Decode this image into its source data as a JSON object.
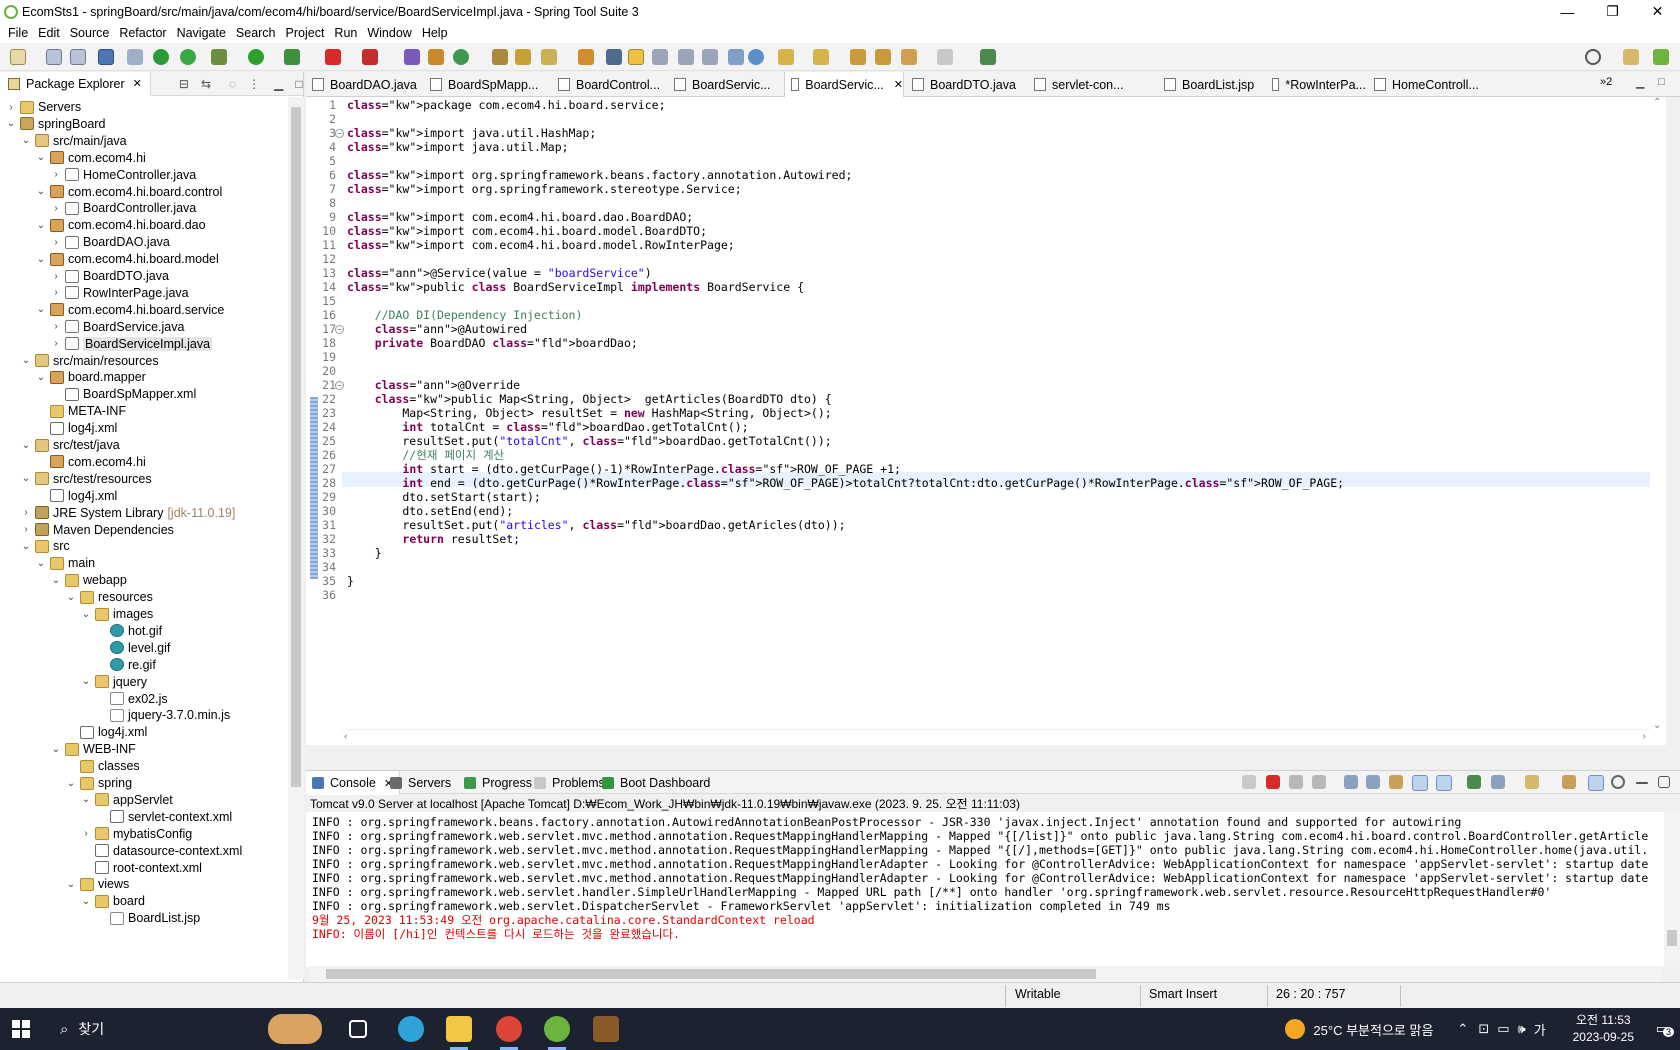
{
  "window": {
    "title": "EcomSts1 - springBoard/src/main/java/com/ecom4/hi/board/service/BoardServiceImpl.java - Spring Tool Suite 3",
    "minimize": "—",
    "maximize": "❐",
    "close": "✕"
  },
  "menu": [
    "File",
    "Edit",
    "Source",
    "Refactor",
    "Navigate",
    "Search",
    "Project",
    "Run",
    "Window",
    "Help"
  ],
  "package_explorer": {
    "tab_label": "Package Explorer",
    "tree": [
      {
        "label": "Servers",
        "icon": "folder",
        "toggle": "›"
      },
      {
        "label": "springBoard",
        "icon": "project",
        "toggle": "⌄"
      },
      {
        "label": "src/main/java",
        "icon": "source-folder",
        "toggle": "⌄"
      },
      {
        "label": "com.ecom4.hi",
        "icon": "package",
        "toggle": "⌄"
      },
      {
        "label": "HomeController.java",
        "icon": "java-file",
        "toggle": "›"
      },
      {
        "label": "com.ecom4.hi.board.control",
        "icon": "package",
        "toggle": "⌄"
      },
      {
        "label": "BoardController.java",
        "icon": "java-file",
        "toggle": "›"
      },
      {
        "label": "com.ecom4.hi.board.dao",
        "icon": "package",
        "toggle": "⌄"
      },
      {
        "label": "BoardDAO.java",
        "icon": "java-file",
        "toggle": "›"
      },
      {
        "label": "com.ecom4.hi.board.model",
        "icon": "package",
        "toggle": "⌄"
      },
      {
        "label": "BoardDTO.java",
        "icon": "java-file",
        "toggle": "›"
      },
      {
        "label": "RowInterPage.java",
        "icon": "java-file",
        "toggle": "›"
      },
      {
        "label": "com.ecom4.hi.board.service",
        "icon": "package",
        "toggle": "⌄"
      },
      {
        "label": "BoardService.java",
        "icon": "java-file",
        "toggle": "›"
      },
      {
        "label": "BoardServiceImpl.java",
        "icon": "java-file",
        "toggle": "›",
        "selected": true
      },
      {
        "label": "src/main/resources",
        "icon": "source-folder",
        "toggle": "⌄"
      },
      {
        "label": "board.mapper",
        "icon": "package",
        "toggle": "⌄"
      },
      {
        "label": "BoardSpMapper.xml",
        "icon": "xml-file",
        "toggle": ""
      },
      {
        "label": "META-INF",
        "icon": "folder",
        "toggle": ""
      },
      {
        "label": "log4j.xml",
        "icon": "xml-file",
        "toggle": ""
      },
      {
        "label": "src/test/java",
        "icon": "source-folder",
        "toggle": "⌄"
      },
      {
        "label": "com.ecom4.hi",
        "icon": "package",
        "toggle": ""
      },
      {
        "label": "src/test/resources",
        "icon": "source-folder",
        "toggle": "⌄"
      },
      {
        "label": "log4j.xml",
        "icon": "xml-file",
        "toggle": ""
      },
      {
        "label": "JRE System Library",
        "icon": "library",
        "toggle": "›",
        "suffix": "[jdk-11.0.19]"
      },
      {
        "label": "Maven Dependencies",
        "icon": "library",
        "toggle": "›"
      },
      {
        "label": "src",
        "icon": "folder",
        "toggle": "⌄"
      },
      {
        "label": "main",
        "icon": "folder",
        "toggle": "⌄"
      },
      {
        "label": "webapp",
        "icon": "folder",
        "toggle": "⌄"
      },
      {
        "label": "resources",
        "icon": "folder",
        "toggle": "⌄"
      },
      {
        "label": "images",
        "icon": "folder",
        "toggle": "⌄"
      },
      {
        "label": "hot.gif",
        "icon": "gif-file",
        "toggle": ""
      },
      {
        "label": "level.gif",
        "icon": "gif-file",
        "toggle": ""
      },
      {
        "label": "re.gif",
        "icon": "gif-file",
        "toggle": ""
      },
      {
        "label": "jquery",
        "icon": "folder",
        "toggle": "⌄"
      },
      {
        "label": "ex02.js",
        "icon": "js-file",
        "toggle": ""
      },
      {
        "label": "jquery-3.7.0.min.js",
        "icon": "js-file",
        "toggle": ""
      },
      {
        "label": "log4j.xml",
        "icon": "xml-file",
        "toggle": ""
      },
      {
        "label": "WEB-INF",
        "icon": "folder",
        "toggle": "⌄"
      },
      {
        "label": "classes",
        "icon": "folder",
        "toggle": ""
      },
      {
        "label": "spring",
        "icon": "folder",
        "toggle": "⌄"
      },
      {
        "label": "appServlet",
        "icon": "folder",
        "toggle": "⌄"
      },
      {
        "label": "servlet-context.xml",
        "icon": "xml-file",
        "toggle": ""
      },
      {
        "label": "mybatisConfig",
        "icon": "folder",
        "toggle": "›"
      },
      {
        "label": "datasource-context.xml",
        "icon": "xml-file",
        "toggle": ""
      },
      {
        "label": "root-context.xml",
        "icon": "xml-file",
        "toggle": ""
      },
      {
        "label": "views",
        "icon": "folder",
        "toggle": "⌄"
      },
      {
        "label": "board",
        "icon": "folder",
        "toggle": "⌄"
      },
      {
        "label": "BoardList.jsp",
        "icon": "jsp-file",
        "toggle": ""
      }
    ]
  },
  "editor_tabs": [
    {
      "label": "BoardDAO.java"
    },
    {
      "label": "BoardSpMapp..."
    },
    {
      "label": "BoardControl..."
    },
    {
      "label": "BoardServic..."
    },
    {
      "label": "BoardServic...",
      "active": true
    },
    {
      "label": "BoardDTO.java"
    },
    {
      "label": "servlet-con..."
    },
    {
      "label": "BoardList.jsp"
    },
    {
      "label": "*RowInterPa..."
    },
    {
      "label": "HomeControll..."
    }
  ],
  "editor_overflow": "»2",
  "code_lines": [
    "package com.ecom4.hi.board.service;",
    "",
    "import java.util.HashMap;",
    "import java.util.Map;",
    "",
    "import org.springframework.beans.factory.annotation.Autowired;",
    "import org.springframework.stereotype.Service;",
    "",
    "import com.ecom4.hi.board.dao.BoardDAO;",
    "import com.ecom4.hi.board.model.BoardDTO;",
    "import com.ecom4.hi.board.model.RowInterPage;",
    "",
    "@Service(value = \"boardService\")",
    "public class BoardServiceImpl implements BoardService {",
    "",
    "    //DAO DI(Dependency Injection)",
    "    @Autowired",
    "    private BoardDAO boardDao;",
    "",
    "",
    "    @Override",
    "    public Map<String, Object>  getArticles(BoardDTO dto) {",
    "        Map<String, Object> resultSet = new HashMap<String, Object>();",
    "        int totalCnt = boardDao.getTotalCnt();",
    "        resultSet.put(\"totalCnt\", boardDao.getTotalCnt());",
    "        //현재 페이지 계산",
    "        int start = (dto.getCurPage()-1)*RowInterPage.ROW_OF_PAGE +1;",
    "        int end = (dto.getCurPage()*RowInterPage.ROW_OF_PAGE)>totalCnt?totalCnt:dto.getCurPage()*RowInterPage.ROW_OF_PAGE;",
    "        dto.setStart(start);",
    "        dto.setEnd(end);",
    "        resultSet.put(\"articles\", boardDao.getAricles(dto));",
    "        return resultSet;",
    "    }",
    "",
    "}",
    ""
  ],
  "console_tabs": [
    {
      "label": "Console",
      "active": true
    },
    {
      "label": "Servers"
    },
    {
      "label": "Progress"
    },
    {
      "label": "Problems"
    },
    {
      "label": "Boot Dashboard"
    }
  ],
  "server_line": "Tomcat v9.0 Server at localhost [Apache Tomcat] D:₩Ecom_Work_JH₩bin₩jdk-11.0.19₩bin₩javaw.exe  (2023. 9. 25. 오전 11:11:03)",
  "console_lines": [
    {
      "text": "INFO : org.springframework.beans.factory.annotation.AutowiredAnnotationBeanPostProcessor - JSR-330 'javax.inject.Inject' annotation found and supported for autowiring",
      "color": "black"
    },
    {
      "text": "INFO : org.springframework.web.servlet.mvc.method.annotation.RequestMappingHandlerMapping - Mapped \"{[/list]}\" onto public java.lang.String com.ecom4.hi.board.control.BoardController.getArticle",
      "color": "black"
    },
    {
      "text": "INFO : org.springframework.web.servlet.mvc.method.annotation.RequestMappingHandlerMapping - Mapped \"{[/],methods=[GET]}\" onto public java.lang.String com.ecom4.hi.HomeController.home(java.util.",
      "color": "black"
    },
    {
      "text": "INFO : org.springframework.web.servlet.mvc.method.annotation.RequestMappingHandlerAdapter - Looking for @ControllerAdvice: WebApplicationContext for namespace 'appServlet-servlet': startup date",
      "color": "black"
    },
    {
      "text": "INFO : org.springframework.web.servlet.mvc.method.annotation.RequestMappingHandlerAdapter - Looking for @ControllerAdvice: WebApplicationContext for namespace 'appServlet-servlet': startup date",
      "color": "black"
    },
    {
      "text": "INFO : org.springframework.web.servlet.handler.SimpleUrlHandlerMapping - Mapped URL path [/**] onto handler 'org.springframework.web.servlet.resource.ResourceHttpRequestHandler#0'",
      "color": "black"
    },
    {
      "text": "INFO : org.springframework.web.servlet.DispatcherServlet - FrameworkServlet 'appServlet': initialization completed in 749 ms",
      "color": "black"
    },
    {
      "text": "9월 25, 2023 11:53:49 오전 org.apache.catalina.core.StandardContext reload",
      "color": "red"
    },
    {
      "text": "INFO: 이름이 [/hi]인 컨텍스트를 다시 로드하는 것을 완료했습니다.",
      "color": "red"
    }
  ],
  "status": {
    "writable": "Writable",
    "insert_mode": "Smart Insert",
    "position": "26 : 20 : 757"
  },
  "taskbar": {
    "search_placeholder": "찾기",
    "weather": "25°C 부분적으로 맑음",
    "ime": "가",
    "time": "오전 11:53",
    "date": "2023-09-25",
    "notification_count": "3"
  },
  "colors": {
    "keyword": "#7f0055",
    "string": "#2a00ff",
    "comment": "#3f7f5f",
    "field": "#0000c0",
    "console_error": "#e00000",
    "current_line": "#e8f2fe"
  }
}
